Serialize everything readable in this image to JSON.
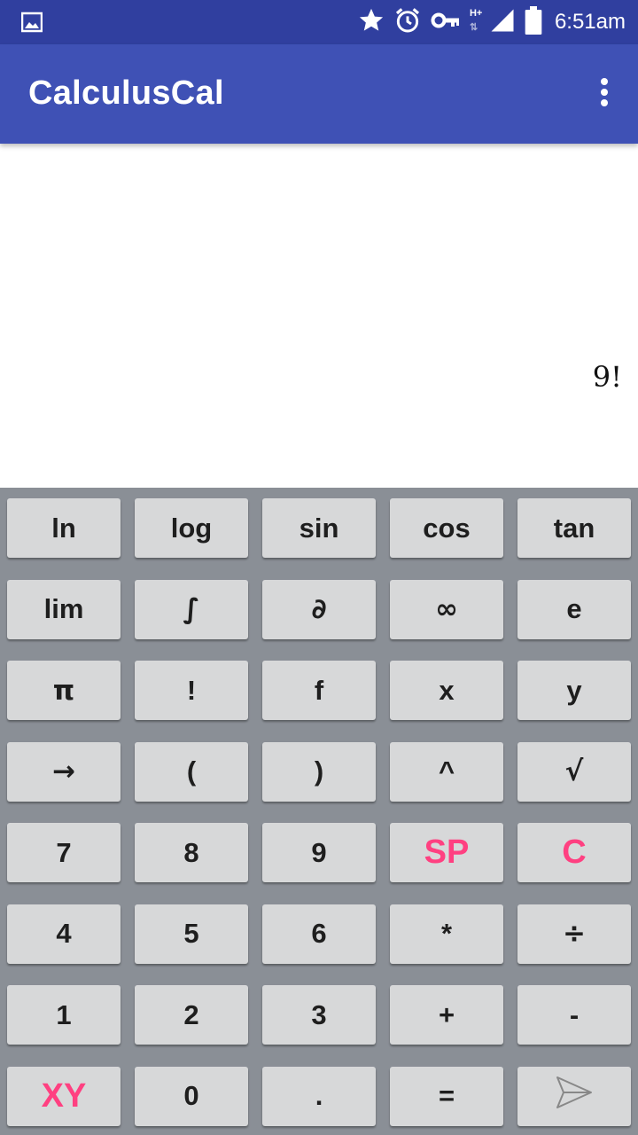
{
  "status_bar": {
    "time": "6:51am",
    "network_label": "H+",
    "icons": [
      "image-icon",
      "star-icon",
      "alarm-icon",
      "vpn-key-icon",
      "signal-icon",
      "battery-icon"
    ]
  },
  "app_bar": {
    "title": "CalculusCal",
    "menu_icon": "overflow-menu-icon"
  },
  "display": {
    "expression": "9!"
  },
  "keypad": {
    "rows": [
      [
        "ln",
        "log",
        "sin",
        "cos",
        "tan"
      ],
      [
        "lim",
        "∫",
        "∂",
        "∞",
        "e"
      ],
      [
        "π",
        "!",
        "f",
        "x",
        "y"
      ],
      [
        "→",
        "(",
        ")",
        "^",
        "√"
      ],
      [
        "7",
        "8",
        "9",
        "SP",
        "C"
      ],
      [
        "4",
        "5",
        "6",
        "*",
        "÷"
      ],
      [
        "1",
        "2",
        "3",
        "+",
        "-"
      ],
      [
        "XY",
        "0",
        ".",
        "=",
        ""
      ]
    ],
    "send_icon": "send-icon",
    "accent_color": "#FF4081"
  },
  "colors": {
    "status_bar": "#303F9F",
    "app_bar": "#3F51B5",
    "keypad_bg": "#8A8F96",
    "key_bg": "#D7D8D9"
  }
}
